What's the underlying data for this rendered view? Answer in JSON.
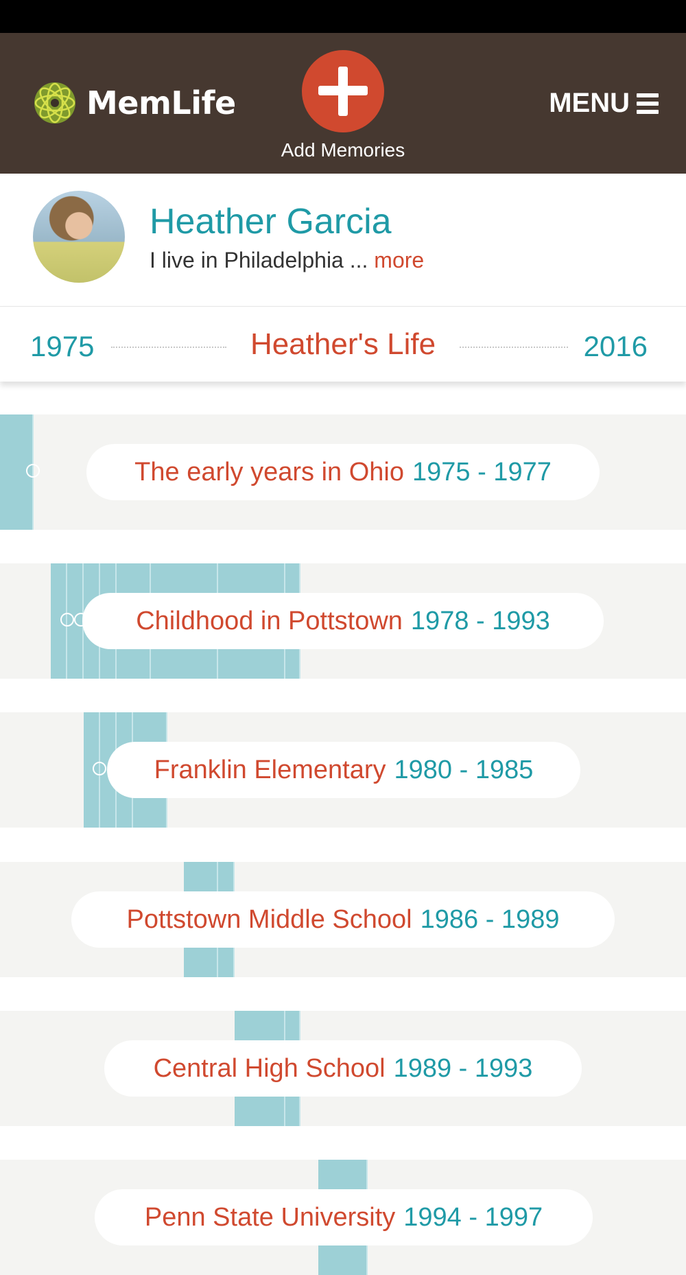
{
  "header": {
    "brand": "MemLife",
    "add_label": "Add Memories",
    "menu_label": "MENU"
  },
  "profile": {
    "name": "Heather Garcia",
    "bio": "I live in Philadelphia ... ",
    "more_label": "more"
  },
  "lifebar": {
    "start_year": "1975",
    "title": "Heather's Life",
    "end_year": "2016"
  },
  "chapters": [
    {
      "title": "The early years in Ohio",
      "years": "1975 - 1977"
    },
    {
      "title": "Childhood in Pottstown",
      "years": "1978 - 1993"
    },
    {
      "title": "Franklin Elementary",
      "years": "1980 - 1985"
    },
    {
      "title": "Pottstown Middle School",
      "years": "1986 - 1989"
    },
    {
      "title": "Central High School",
      "years": "1989 - 1993"
    },
    {
      "title": "Penn State University",
      "years": "1994 - 1997"
    }
  ],
  "colors": {
    "header_bg": "#463830",
    "accent_red": "#d0492f",
    "accent_teal": "#1f9aa6",
    "bar_teal": "#9dd0d6"
  }
}
